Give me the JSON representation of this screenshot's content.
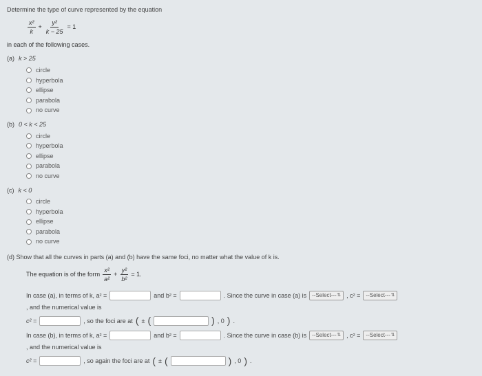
{
  "header": "Determine the type of curve represented by the equation",
  "main_equation": {
    "term1_num": "x²",
    "term1_den": "k",
    "plus": "+",
    "term2_num": "y²",
    "term2_den": "k − 25",
    "eq": "= 1"
  },
  "sub_text": "in each of the following cases.",
  "cases": {
    "a": {
      "label": "(a)",
      "cond": "k > 25"
    },
    "b": {
      "label": "(b)",
      "cond": "0 < k < 25"
    },
    "c": {
      "label": "(c)",
      "cond": "k < 0"
    }
  },
  "options": [
    "circle",
    "hyperbola",
    "ellipse",
    "parabola",
    "no curve"
  ],
  "part_d": {
    "label": "(d)",
    "text": "Show that all the curves in parts (a) and (b) have the same foci, no matter what the value of k is.",
    "form_text": "The equation is of the form",
    "form_eq": {
      "t1n": "x²",
      "t1d": "a²",
      "plus": "+",
      "t2n": "y²",
      "t2d": "b²",
      "eq": "= 1."
    },
    "case_a_1": "In case (a), in terms of k, a² =",
    "and_b2": "and b² =",
    "since_a": ". Since the curve in case (a) is",
    "comma_c2": ", c² =",
    "and_num": ", and the numerical value is",
    "c2_eq": "c² =",
    "foci_text": ", so the foci are at",
    "foci_again": ", so again the foci are at",
    "pm": "±",
    "zero_paren": ", 0",
    "close_paren": ".",
    "case_b_1": "In case (b), in terms of k, a² =",
    "since_b": ". Since the curve in case (b) is",
    "select_text": "--Select---",
    "arrows": "⇅"
  }
}
